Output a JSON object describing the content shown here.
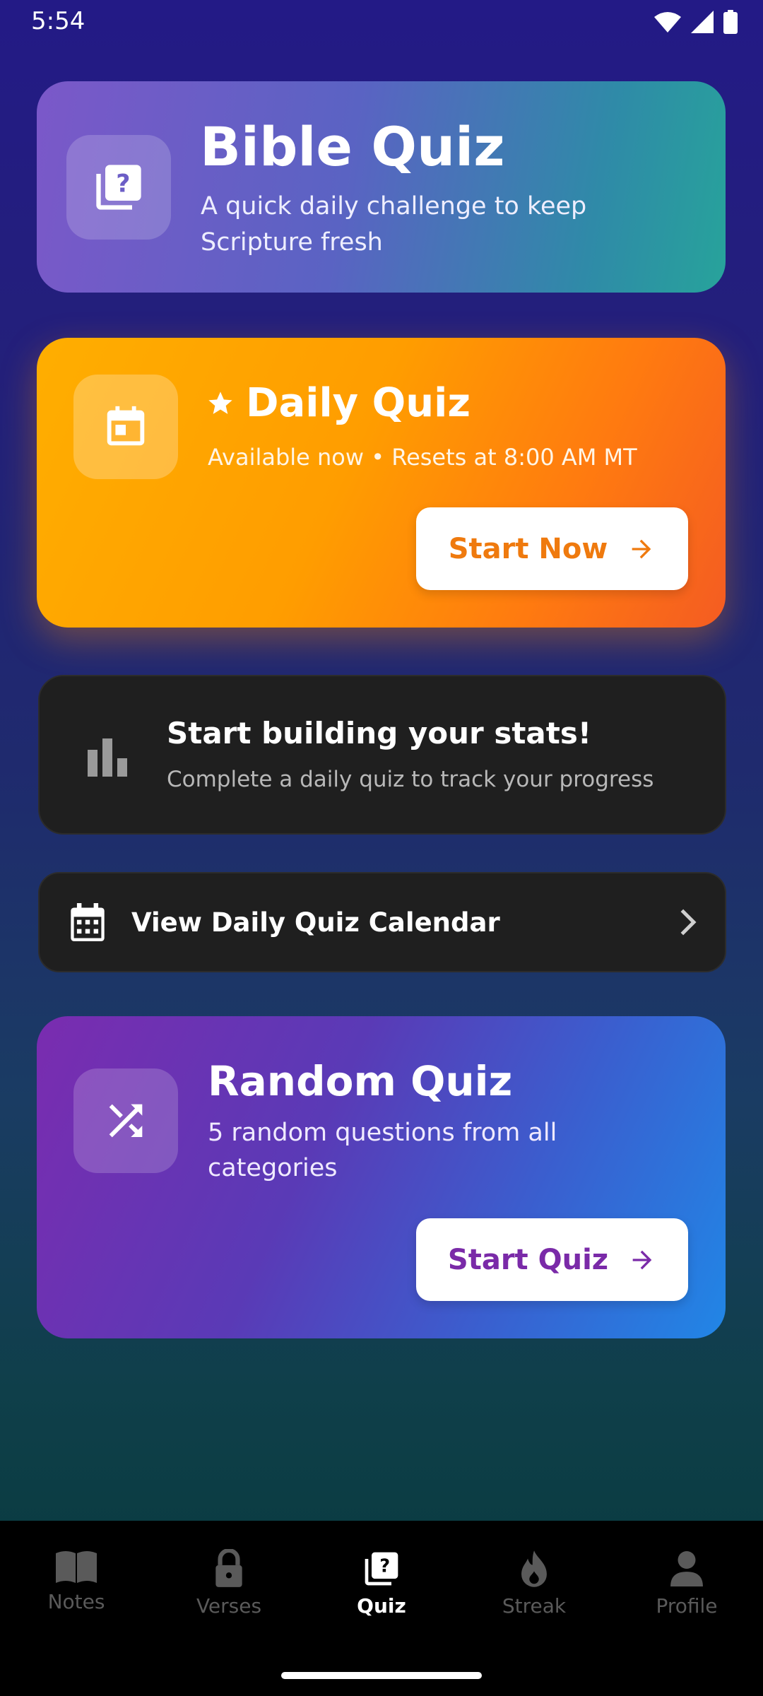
{
  "status": {
    "time": "5:54"
  },
  "header": {
    "title": "Bible Quiz",
    "subtitle": "A quick daily challenge to keep Scripture fresh"
  },
  "daily": {
    "title": "Daily Quiz",
    "subtitle": "Available now • Resets at 8:00 AM MT",
    "button": "Start Now"
  },
  "stats": {
    "title": "Start building your stats!",
    "subtitle": "Complete a daily quiz to track your progress"
  },
  "calendar": {
    "label": "View Daily Quiz Calendar"
  },
  "random": {
    "title": "Random Quiz",
    "subtitle": "5 random questions from all categories",
    "button": "Start Quiz"
  },
  "nav": {
    "items": [
      {
        "label": "Notes",
        "icon": "book-icon"
      },
      {
        "label": "Verses",
        "icon": "lock-icon"
      },
      {
        "label": "Quiz",
        "icon": "quiz-icon"
      },
      {
        "label": "Streak",
        "icon": "flame-icon"
      },
      {
        "label": "Profile",
        "icon": "person-icon"
      }
    ],
    "active": "Quiz"
  },
  "colors": {
    "daily_accent": "#ef7a0e",
    "random_accent": "#7a2aa8",
    "nav_inactive": "#5a5a5a"
  }
}
